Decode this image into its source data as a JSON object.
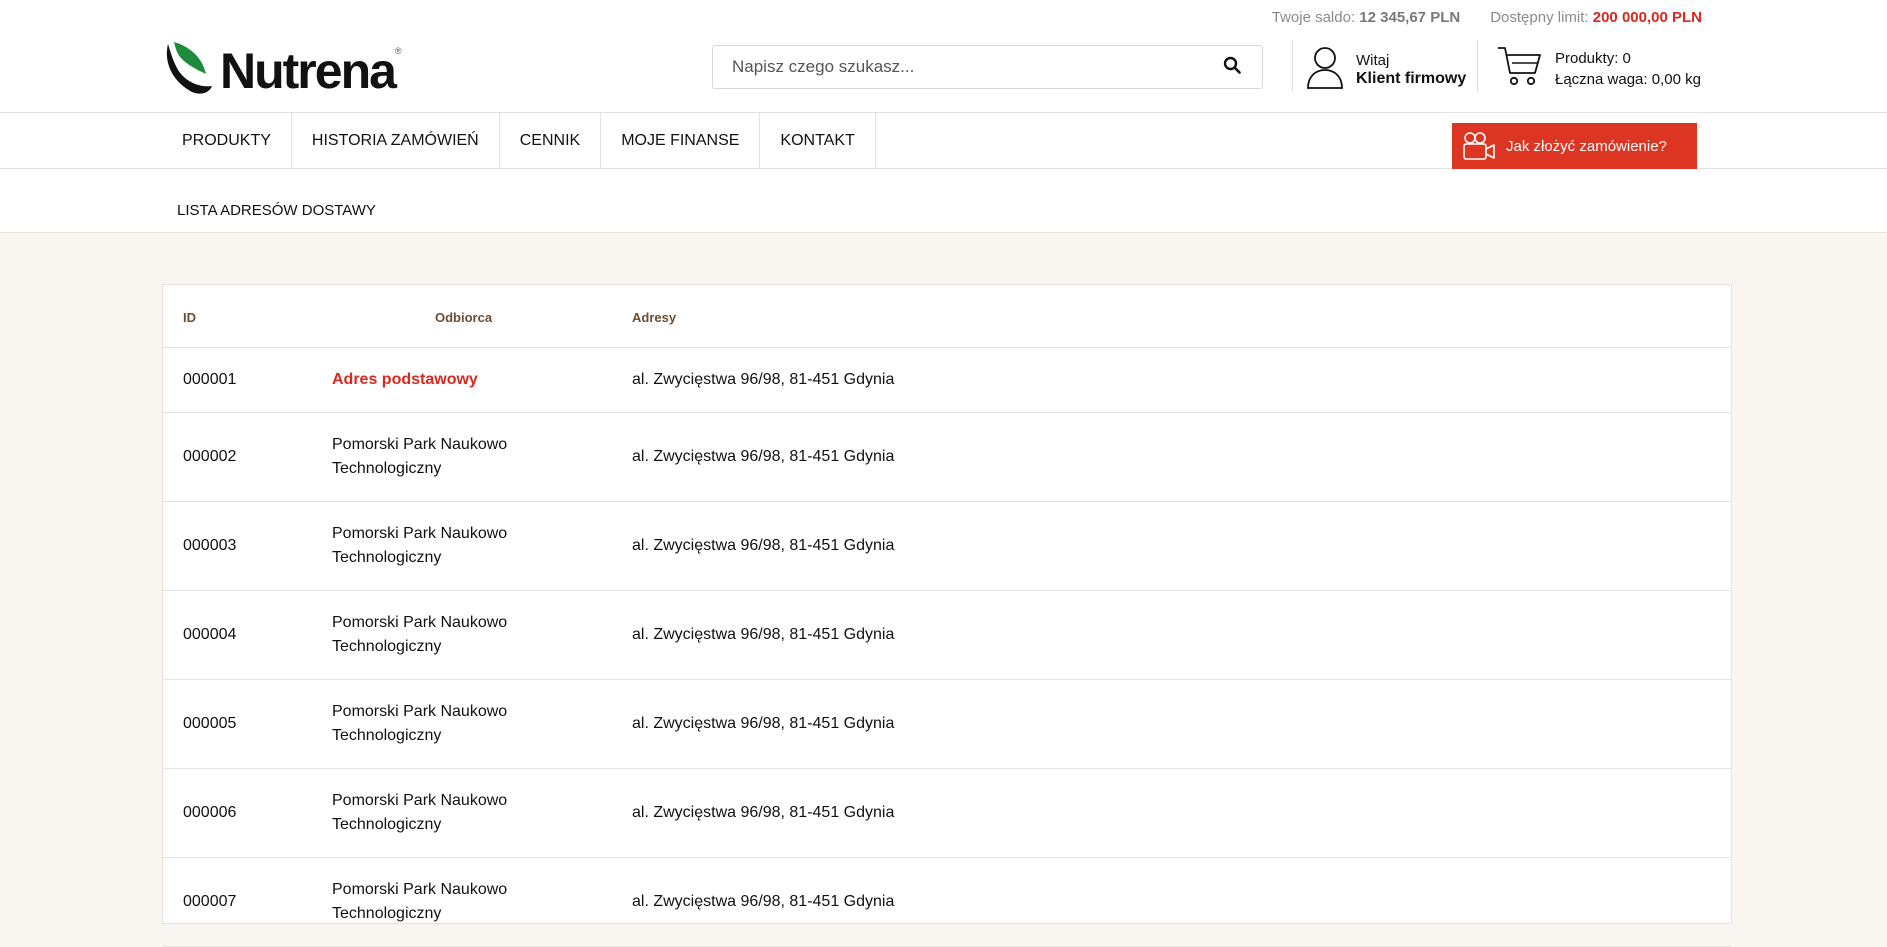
{
  "balances": {
    "saldo_label": "Twoje saldo:",
    "saldo_value": "12 345,67 PLN",
    "limit_label": "Dostępny limit:",
    "limit_value": "200 000,00 PLN"
  },
  "logo": {
    "word": "Nutrena",
    "reg": "®",
    "icon": "leaf-logo-icon"
  },
  "search": {
    "placeholder": "Napisz czego szukasz...",
    "icon": "search-icon"
  },
  "user": {
    "greeting": "Witaj",
    "name": "Klient firmowy",
    "icon": "user-icon"
  },
  "cart": {
    "products": "Produkty: 0",
    "weight": "Łączna waga: 0,00 kg",
    "icon": "cart-icon"
  },
  "nav": {
    "items": [
      "PRODUKTY",
      "HISTORIA ZAMÓWIEŃ",
      "CENNIK",
      "MOJE FINANSE",
      "KONTAKT"
    ],
    "howto": "Jak złożyć zamówienie?",
    "howto_icon": "video-camera-icon"
  },
  "page": {
    "title": "LISTA ADRESÓW DOSTAWY"
  },
  "table": {
    "headers": {
      "id": "ID",
      "recipient": "Odbiorca",
      "address": "Adresy"
    },
    "rows": [
      {
        "id": "000001",
        "recipient_line1": "Adres podstawowy",
        "recipient_line2": "",
        "address": "al. Zwycięstwa 96/98, 81-451 Gdynia"
      },
      {
        "id": "000002",
        "recipient_line1": "Pomorski Park Naukowo",
        "recipient_line2": "Technologiczny",
        "address": "al. Zwycięstwa 96/98, 81-451 Gdynia"
      },
      {
        "id": "000003",
        "recipient_line1": "Pomorski Park Naukowo",
        "recipient_line2": "Technologiczny",
        "address": "al. Zwycięstwa 96/98, 81-451 Gdynia"
      },
      {
        "id": "000004",
        "recipient_line1": "Pomorski Park Naukowo",
        "recipient_line2": "Technologiczny",
        "address": "al. Zwycięstwa 96/98, 81-451 Gdynia"
      },
      {
        "id": "000005",
        "recipient_line1": "Pomorski Park Naukowo",
        "recipient_line2": "Technologiczny",
        "address": "al. Zwycięstwa 96/98, 81-451 Gdynia"
      },
      {
        "id": "000006",
        "recipient_line1": "Pomorski Park Naukowo",
        "recipient_line2": "Technologiczny",
        "address": "al. Zwycięstwa 96/98, 81-451 Gdynia"
      },
      {
        "id": "000007",
        "recipient_line1": "Pomorski Park Naukowo",
        "recipient_line2": "Technologiczny",
        "address": "al. Zwycięstwa 96/98, 81-451 Gdynia"
      }
    ]
  },
  "colors": {
    "accent": "#d8281f",
    "button": "#dc3522",
    "header_text": "#6b4d34",
    "leaf_green": "#1e8a3c",
    "leaf_dark": "#111111"
  }
}
